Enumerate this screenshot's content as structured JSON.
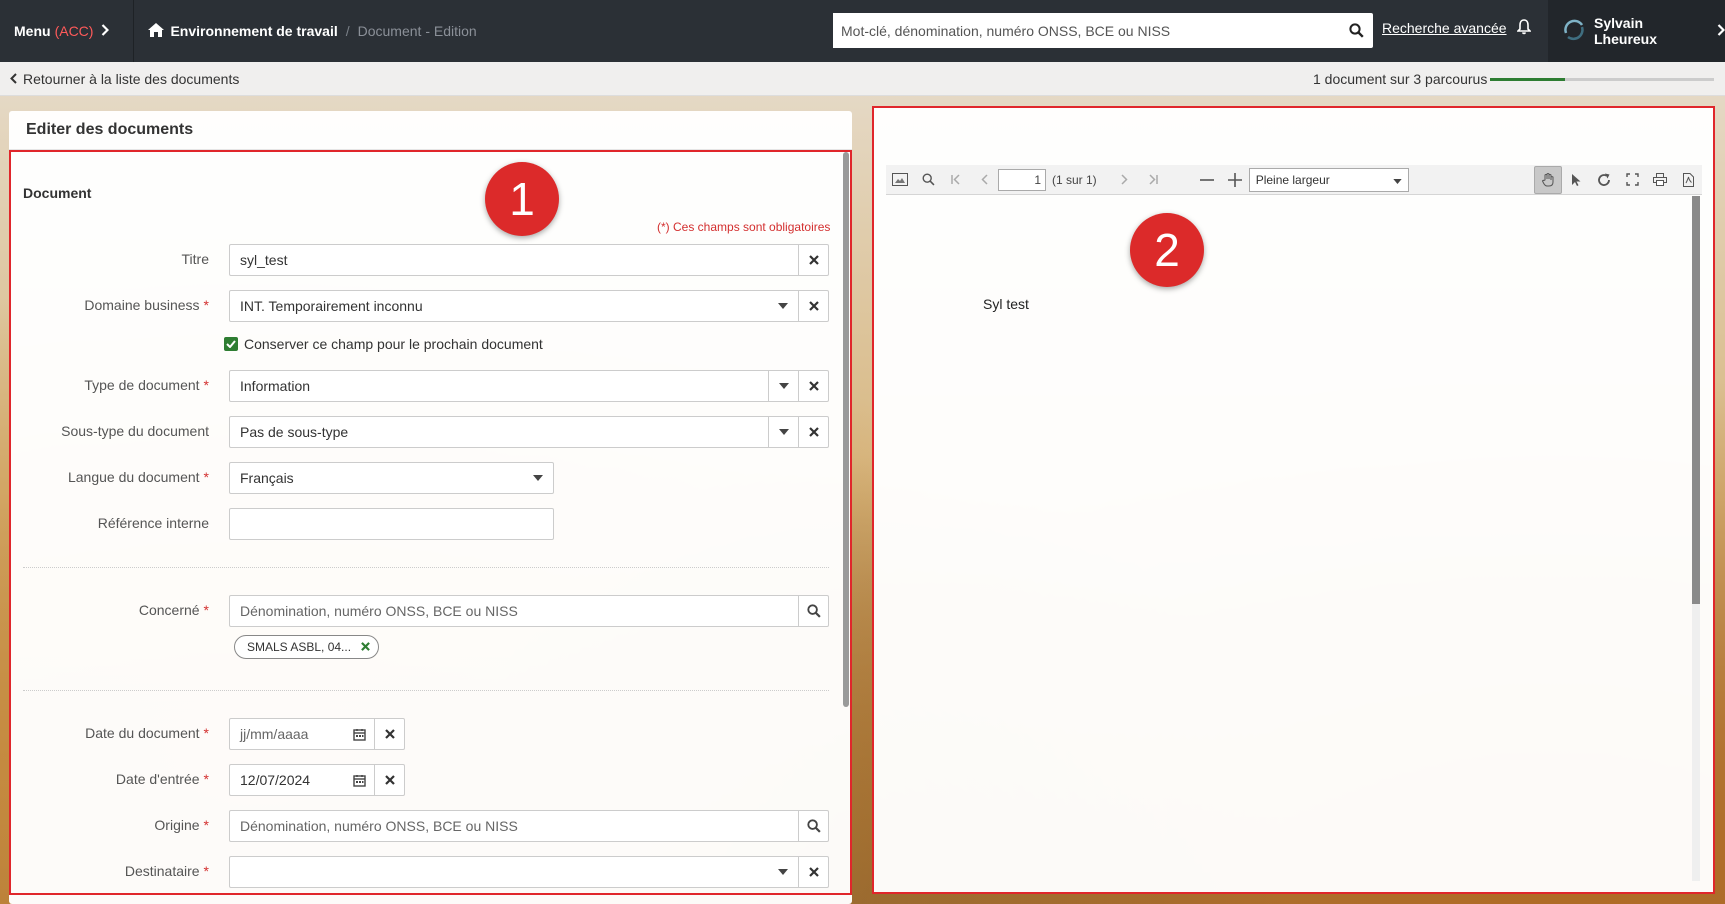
{
  "topbar": {
    "menu_label": "Menu",
    "env_tag": "(ACC)",
    "home_label": "Environnement de travail",
    "breadcrumb_sep": "/",
    "breadcrumb_current": "Document - Edition",
    "search_placeholder": "Mot-clé, dénomination, numéro ONSS, BCE ou NISS",
    "advanced_search": "Recherche avancée",
    "user_name": "Sylvain Lheureux"
  },
  "subbar": {
    "back_label": "Retourner à la liste des documents",
    "progress_text": "1 document sur 3 parcourus",
    "progress_fraction": 0.333
  },
  "editor": {
    "panel_title": "Editer des documents",
    "section_title": "Document",
    "mandatory_note": "(*) Ces champs sont obligatoires",
    "badge_1": "1",
    "fields": {
      "titre": {
        "label": "Titre",
        "value": "syl_test"
      },
      "domaine": {
        "label": "Domaine business",
        "value": "INT. Temporairement inconnu"
      },
      "keep_field": {
        "label": "Conserver ce champ pour le prochain document",
        "checked": true
      },
      "type": {
        "label": "Type de document",
        "value": "Information"
      },
      "soustype": {
        "label": "Sous-type du document",
        "value": "Pas de sous-type"
      },
      "langue": {
        "label": "Langue du document",
        "value": "Français"
      },
      "reference": {
        "label": "Référence interne",
        "value": ""
      },
      "concerne": {
        "label": "Concerné",
        "placeholder": "Dénomination, numéro ONSS, BCE ou NISS",
        "chip": "SMALS ASBL, 04..."
      },
      "date_doc": {
        "label": "Date du document",
        "placeholder": "jj/mm/aaaa"
      },
      "date_entree": {
        "label": "Date d'entrée",
        "value": "12/07/2024"
      },
      "origine": {
        "label": "Origine",
        "placeholder": "Dénomination, numéro ONSS, BCE ou NISS"
      },
      "destinataire": {
        "label": "Destinataire",
        "value": ""
      }
    },
    "required_mark": "*"
  },
  "viewer": {
    "badge_2": "2",
    "page_number": "1",
    "page_of": "(1 sur 1)",
    "zoom_option": "Pleine largeur",
    "pdf_content": "Syl test"
  }
}
